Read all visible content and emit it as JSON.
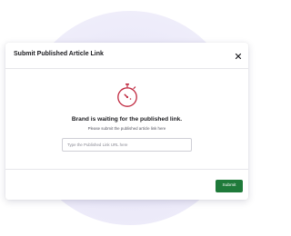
{
  "modal": {
    "title": "Submit Published Article Link",
    "close_icon": "close-icon",
    "status_icon": "stopwatch-icon",
    "heading": "Brand is waiting for the published link.",
    "subtext": "Please submit the published article link here",
    "url_field": {
      "value": "",
      "placeholder": "Type the Published Link URL here"
    },
    "submit_label": "Submit"
  },
  "colors": {
    "accent_green": "#1f7a3a",
    "icon_red": "#c0283f",
    "background_circle": "#e7e5f8"
  }
}
